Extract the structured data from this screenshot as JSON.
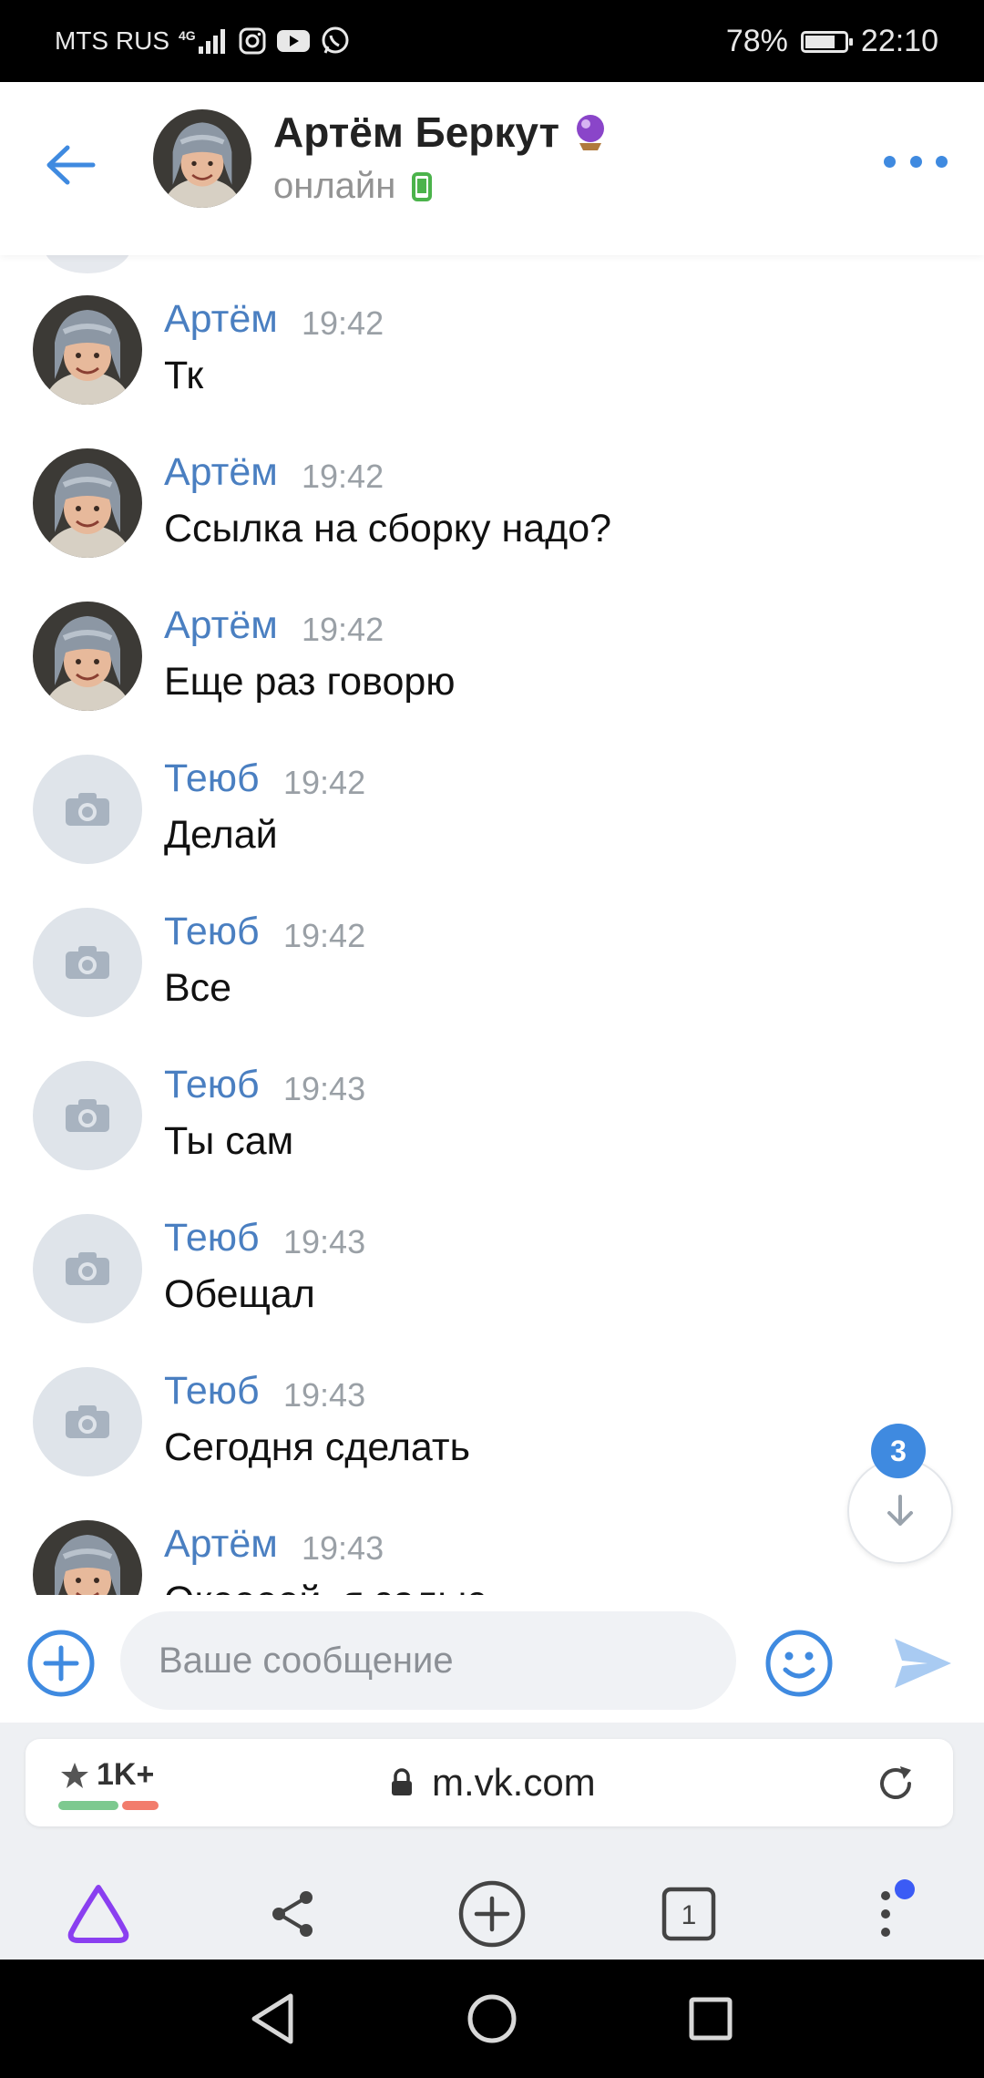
{
  "status_bar": {
    "carrier": "MTS RUS",
    "network": "4G",
    "battery_percent": "78%",
    "time": "22:10",
    "app_icons": [
      "instagram-icon",
      "youtube-icon",
      "whatsapp-icon"
    ]
  },
  "header": {
    "contact_name": "Артём Беркут",
    "status": "онлайн",
    "name_badge": "crystal-ball-icon",
    "status_icon": "mobile-online-icon"
  },
  "messages": [
    {
      "author": "Артём",
      "time": "19:42",
      "text": "Тк",
      "avatar": "photo"
    },
    {
      "author": "Артём",
      "time": "19:42",
      "text": "Ссылка на сборку надо?",
      "avatar": "photo"
    },
    {
      "author": "Артём",
      "time": "19:42",
      "text": "Еще раз говорю",
      "avatar": "photo"
    },
    {
      "author": "Теюб",
      "time": "19:42",
      "text": "Делай",
      "avatar": "camera-placeholder"
    },
    {
      "author": "Теюб",
      "time": "19:42",
      "text": "Все",
      "avatar": "camera-placeholder"
    },
    {
      "author": "Теюб",
      "time": "19:43",
      "text": "Ты сам",
      "avatar": "camera-placeholder"
    },
    {
      "author": "Теюб",
      "time": "19:43",
      "text": "Обещал",
      "avatar": "camera-placeholder"
    },
    {
      "author": "Теюб",
      "time": "19:43",
      "text": "Сегодня сделать",
      "avatar": "camera-placeholder"
    },
    {
      "author": "Артём",
      "time": "19:43",
      "text": "Океееей, я залью",
      "avatar": "photo"
    }
  ],
  "scroll_down": {
    "unread_count": "3"
  },
  "composer": {
    "placeholder": "Ваше сообщение"
  },
  "browser": {
    "rating": "1K+",
    "url": "m.vk.com"
  },
  "colors": {
    "accent": "#3f8ae0",
    "author": "#4a7fc1",
    "alice": "#8a3ff0"
  }
}
